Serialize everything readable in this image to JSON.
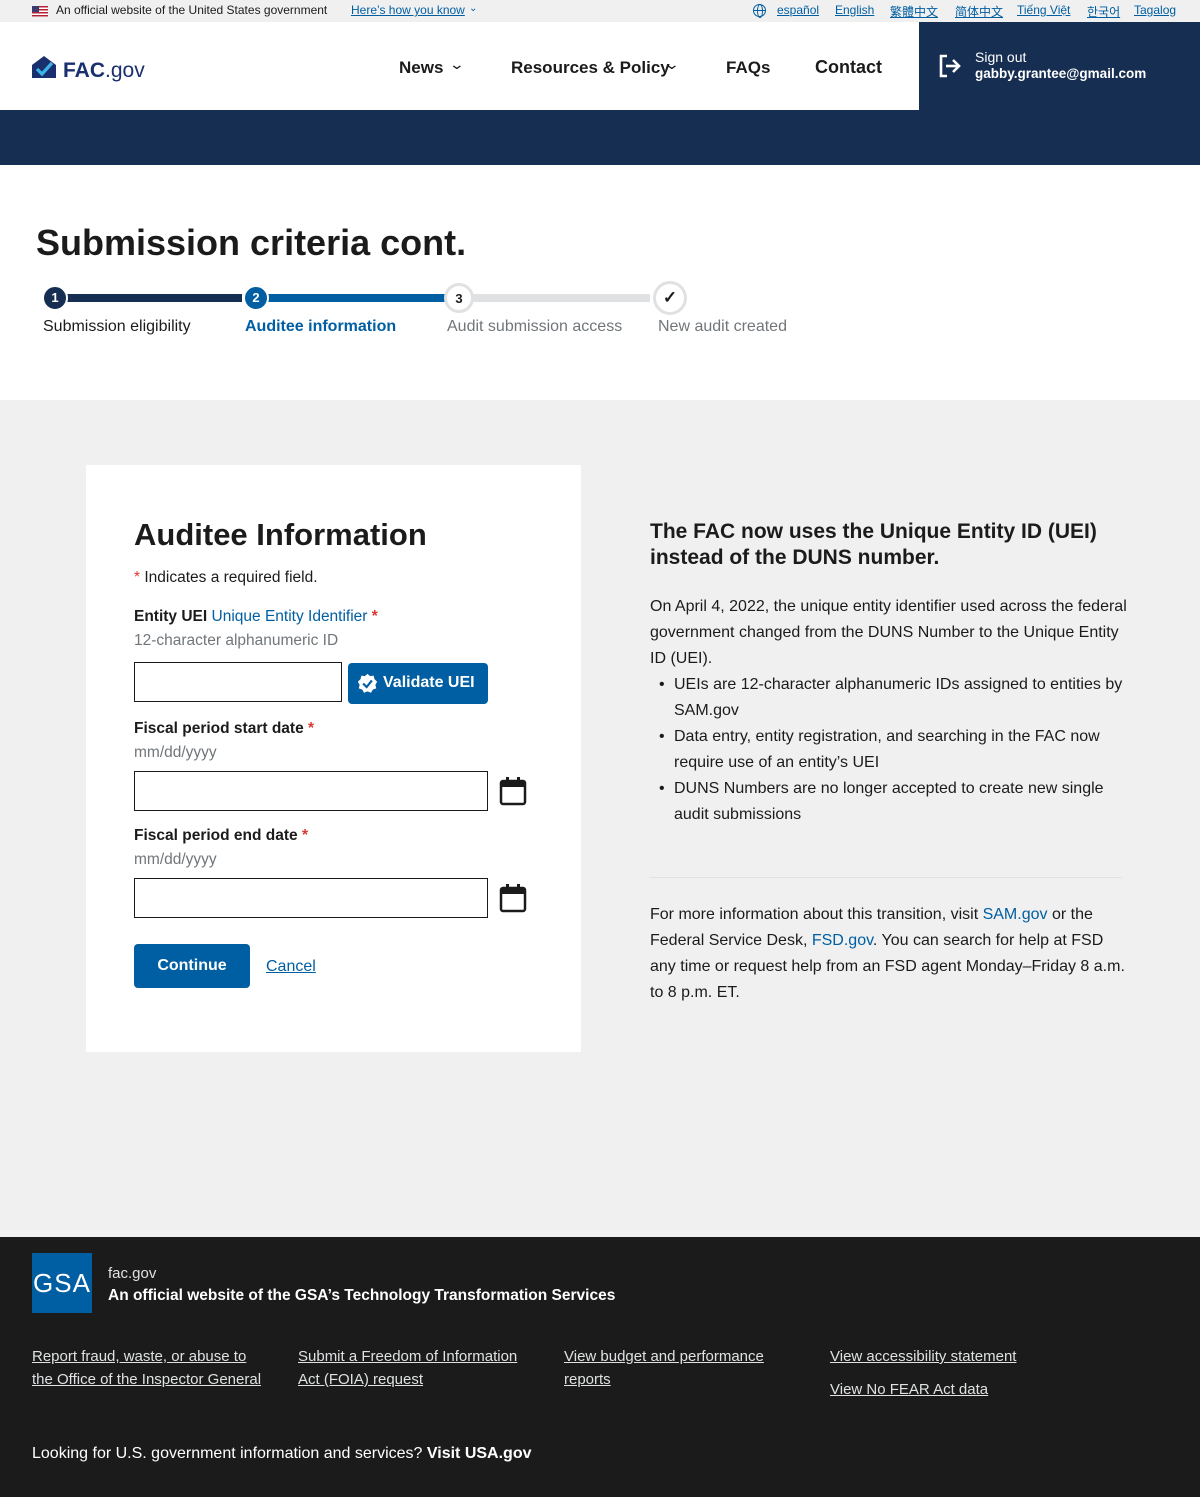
{
  "gov_banner": {
    "official_text": "An official website of the United States government",
    "how_you_know": "Here’s how you know",
    "languages": [
      "español",
      "English",
      "繁體中文",
      "简体中文",
      "Tiếng Việt",
      "한국어",
      "Tagalog"
    ]
  },
  "header": {
    "logo_bold": "FAC",
    "logo_suffix": ".gov",
    "nav": [
      "News",
      "Resources & Policy",
      "FAQs",
      "Contact"
    ],
    "sign_out_label": "Sign out",
    "user_email": "gabby.grantee@gmail.com"
  },
  "page_title": "Submission criteria cont.",
  "steps": [
    {
      "number": "1",
      "label": "Submission eligibility",
      "state": "complete"
    },
    {
      "number": "2",
      "label": "Auditee information",
      "state": "current"
    },
    {
      "number": "3",
      "label": "Audit submission access",
      "state": "upcoming"
    },
    {
      "number": "✓",
      "label": "New audit created",
      "state": "upcoming"
    }
  ],
  "form": {
    "title": "Auditee Information",
    "required_note": "Indicates a required field.",
    "uei_label": "Entity UEI",
    "uei_link": "Unique Entity Identifier",
    "uei_hint": "12-character alphanumeric ID",
    "uei_value": "",
    "validate_button": "Validate UEI",
    "start_label": "Fiscal period start date",
    "start_hint": "mm/dd/yyyy",
    "start_value": "",
    "end_label": "Fiscal period end date",
    "end_hint": "mm/dd/yyyy",
    "end_value": "",
    "continue_button": "Continue",
    "cancel_link": "Cancel"
  },
  "info": {
    "title": "The FAC now uses the Unique Entity ID (UEI) instead of the DUNS number.",
    "intro": "On April 4, 2022, the unique entity identifier used across the federal government changed from the DUNS Number to the Unique Entity ID (UEI).",
    "bullets": [
      "UEIs are 12-character alphanumeric IDs assigned to entities by SAM.gov",
      "Data entry, entity registration, and searching in the FAC now require use of an entity’s UEI",
      "DUNS Numbers are no longer accepted to create new single audit submissions"
    ],
    "more_prefix": "For more information about this transition, visit ",
    "sam_link": "SAM.gov",
    "more_mid": " or the Federal Service Desk, ",
    "fsd_link": "FSD.gov",
    "more_suffix": ". You can search for help at FSD any time or request help from an FSD agent Monday–Friday 8 a.m. to 8 p.m. ET."
  },
  "footer": {
    "gsa_logo_text": "GSA",
    "domain": "fac.gov",
    "official_prefix": "An official website of the ",
    "official_link": "GSA’s Technology Transformation Services",
    "links": [
      "Report fraud, waste, or abuse to the Office of the Inspector General",
      "Submit a Freedom of Information Act (FOIA) request",
      "View budget and performance reports",
      "View accessibility statement",
      "View No FEAR Act data"
    ],
    "usa_prefix": "Looking for U.S. government information and services? ",
    "usa_link": "Visit USA.gov"
  },
  "colors": {
    "primary": "#005ea2",
    "navy": "#162e51",
    "required": "#d83933",
    "footer_bg": "#1b1b1b",
    "gray_bg": "#f0f0f0"
  }
}
